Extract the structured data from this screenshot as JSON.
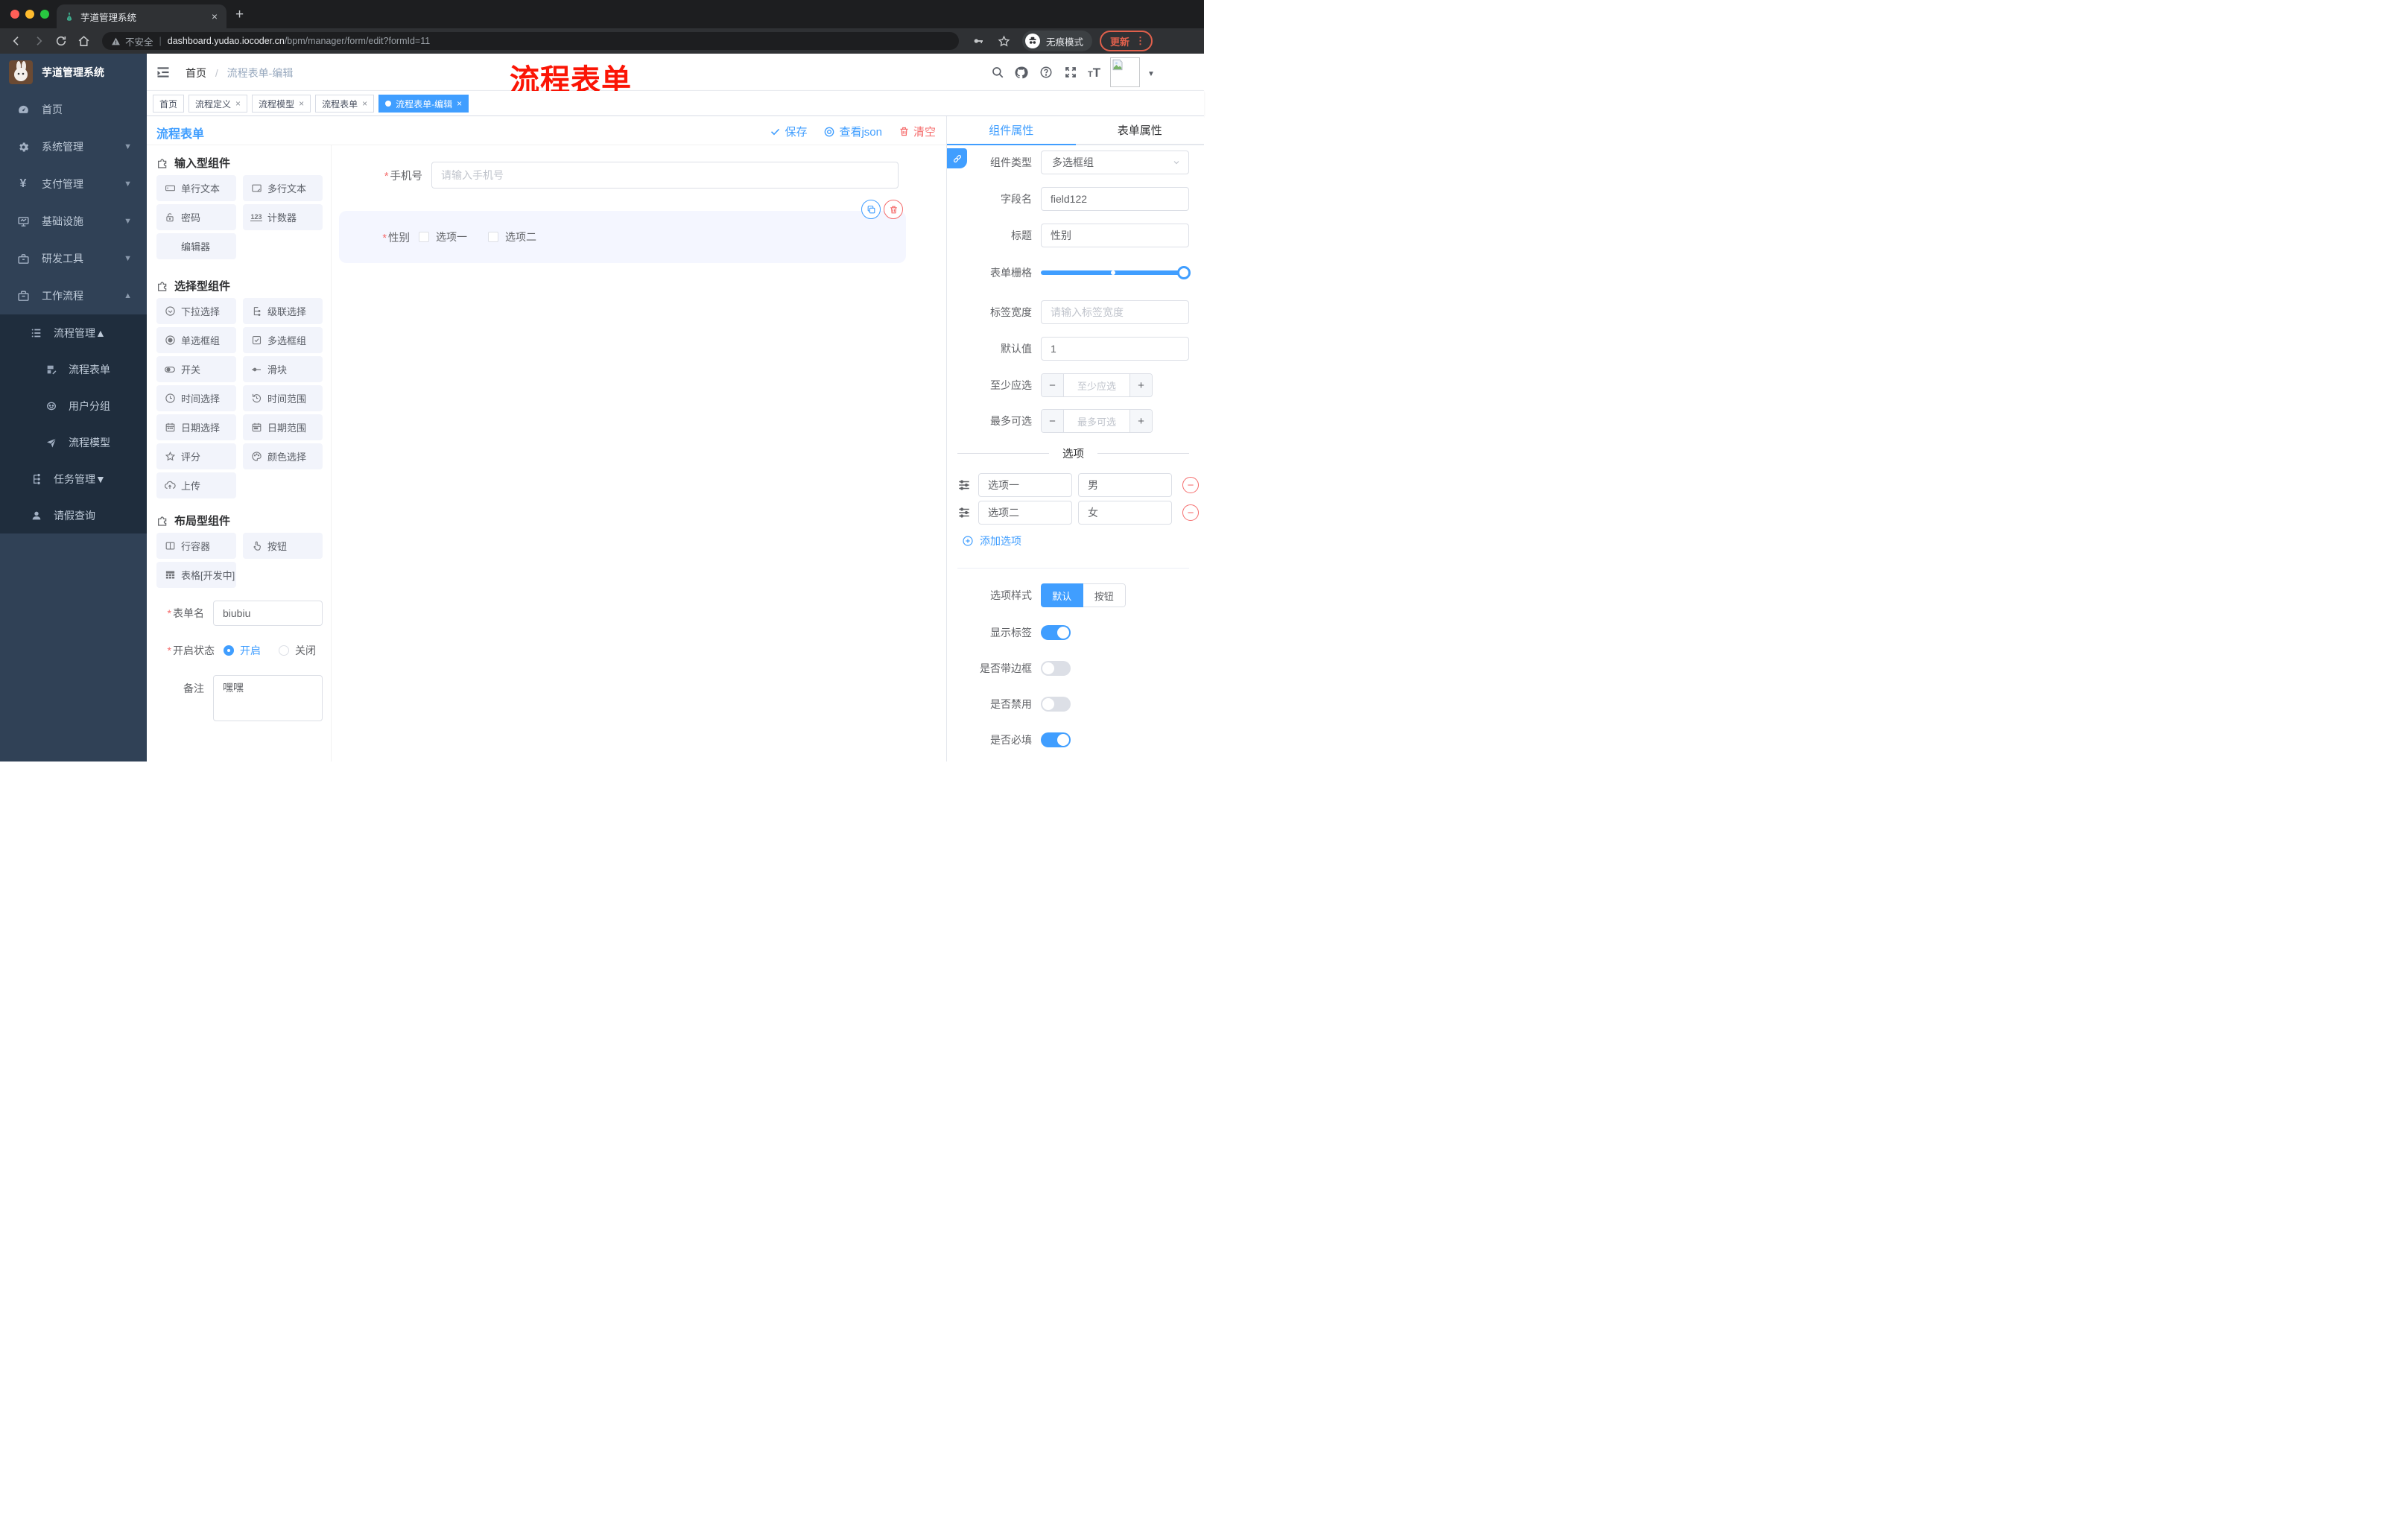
{
  "browser": {
    "tab_title": "芋道管理系统",
    "close_tab": "×",
    "security_label": "不安全",
    "url_domain": "dashboard.yudao.iocoder.cn",
    "url_path": "/bpm/manager/form/edit?formId=11",
    "incognito_label": "无痕模式",
    "update_label": "更新"
  },
  "sidebar": {
    "app_title": "芋道管理系统",
    "items": [
      {
        "label": "首页"
      },
      {
        "label": "系统管理"
      },
      {
        "label": "支付管理"
      },
      {
        "label": "基础设施"
      },
      {
        "label": "研发工具"
      },
      {
        "label": "工作流程"
      }
    ],
    "submenu": [
      {
        "label": "流程管理"
      },
      {
        "label": "流程表单"
      },
      {
        "label": "用户分组"
      },
      {
        "label": "流程模型"
      },
      {
        "label": "任务管理"
      },
      {
        "label": "请假查询"
      }
    ]
  },
  "navbar": {
    "breadcrumb_1": "首页",
    "breadcrumb_sep": "/",
    "breadcrumb_2": "流程表单-编辑",
    "annotation": "流程表单"
  },
  "tags": [
    {
      "label": "首页"
    },
    {
      "label": "流程定义"
    },
    {
      "label": "流程模型"
    },
    {
      "label": "流程表单"
    },
    {
      "label": "流程表单-编辑"
    }
  ],
  "designer": {
    "title": "流程表单",
    "save_label": "保存",
    "view_json_label": "查看json",
    "clear_label": "清空"
  },
  "palette": {
    "sections": [
      {
        "title": "输入型组件",
        "items": [
          "单行文本",
          "多行文本",
          "密码",
          "计数器",
          "编辑器"
        ]
      },
      {
        "title": "选择型组件",
        "items": [
          "下拉选择",
          "级联选择",
          "单选框组",
          "多选框组",
          "开关",
          "滑块",
          "时间选择",
          "时间范围",
          "日期选择",
          "日期范围",
          "评分",
          "颜色选择",
          "上传"
        ]
      },
      {
        "title": "布局型组件",
        "items": [
          "行容器",
          "按钮",
          "表格[开发中]"
        ]
      }
    ]
  },
  "form_meta": {
    "name_label": "表单名",
    "name_value": "biubiu",
    "status_label": "开启状态",
    "status_on": "开启",
    "status_off": "关闭",
    "remark_label": "备注",
    "remark_value": "嘿嘿"
  },
  "canvas": {
    "phone": {
      "label": "手机号",
      "placeholder": "请输入手机号"
    },
    "gender": {
      "label": "性别",
      "option_1": "选项一",
      "option_2": "选项二"
    }
  },
  "inspector": {
    "tab_component": "组件属性",
    "tab_form": "表单属性",
    "component_type_label": "组件类型",
    "component_type_value": "多选框组",
    "field_name_label": "字段名",
    "field_name_value": "field122",
    "title_label": "标题",
    "title_value": "性别",
    "grid_label": "表单栅格",
    "label_width_label": "标签宽度",
    "label_width_placeholder": "请输入标签宽度",
    "default_label": "默认值",
    "default_value": "1",
    "min_label": "至少应选",
    "min_placeholder": "至少应选",
    "max_label": "最多可选",
    "max_placeholder": "最多可选",
    "options_divider": "选项",
    "option_rows": [
      {
        "label": "选项一",
        "value": "男"
      },
      {
        "label": "选项二",
        "value": "女"
      }
    ],
    "add_option_label": "添加选项",
    "option_style_label": "选项样式",
    "style_default": "默认",
    "style_button": "按钮",
    "toggle_show_label": "显示标签",
    "toggle_border": "是否带边框",
    "toggle_disabled": "是否禁用",
    "toggle_required": "是否必填"
  },
  "colors": {
    "accent": "#409eff",
    "danger": "#f56c6c",
    "annotation_red": "#fb1505"
  }
}
